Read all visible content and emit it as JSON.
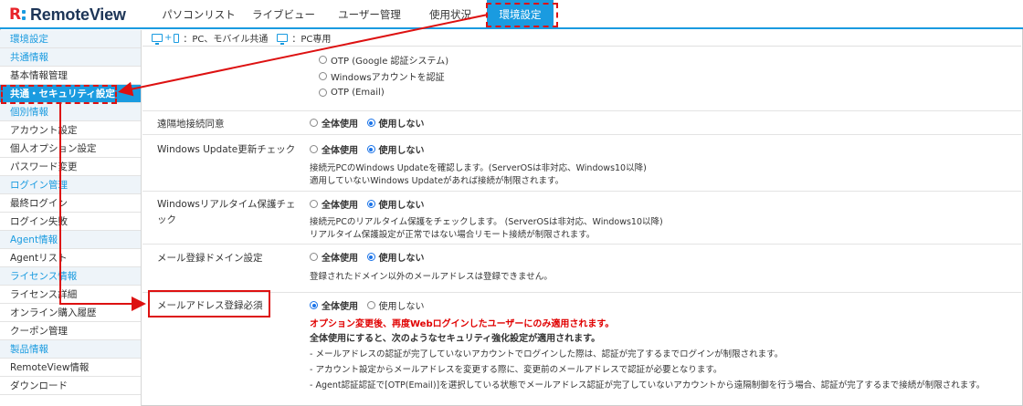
{
  "header": {
    "logo_text": "RemoteView",
    "nav": [
      {
        "label": "パソコンリスト"
      },
      {
        "label": "ライブビュー"
      },
      {
        "label": "ユーザー管理"
      },
      {
        "label": "使用状況"
      },
      {
        "label": "環境設定",
        "active": true
      }
    ]
  },
  "sidebar": {
    "items": [
      {
        "label": "環境設定",
        "type": "head"
      },
      {
        "label": "共通情報",
        "type": "head"
      },
      {
        "label": "基本情報管理",
        "type": "item"
      },
      {
        "label": "共通・セキュリティ設定",
        "type": "active"
      },
      {
        "label": "個別情報",
        "type": "head"
      },
      {
        "label": "アカウント設定",
        "type": "item"
      },
      {
        "label": "個人オプション設定",
        "type": "item"
      },
      {
        "label": "パスワード変更",
        "type": "item"
      },
      {
        "label": "ログイン管理",
        "type": "head"
      },
      {
        "label": "最終ログイン",
        "type": "item"
      },
      {
        "label": "ログイン失敗",
        "type": "item"
      },
      {
        "label": "Agent情報",
        "type": "head"
      },
      {
        "label": "Agentリスト",
        "type": "item"
      },
      {
        "label": "ライセンス情報",
        "type": "head"
      },
      {
        "label": "ライセンス詳細",
        "type": "item"
      },
      {
        "label": "オンライン購入履歴",
        "type": "item"
      },
      {
        "label": "クーポン管理",
        "type": "item"
      },
      {
        "label": "製品情報",
        "type": "head"
      },
      {
        "label": "RemoteView情報",
        "type": "item"
      },
      {
        "label": "ダウンロード",
        "type": "item"
      }
    ]
  },
  "legend": {
    "pc_mobile": "：PC、モバイル共通",
    "pc_only": "：PC専用"
  },
  "auth_options": [
    "OTP (Google 認証システム)",
    "Windowsアカウントを認証",
    "OTP (Email)"
  ],
  "settings": {
    "use_all": "全体使用",
    "not_use": "使用しない",
    "remote_consent": {
      "label": "遠隔地接続同意"
    },
    "windows_update": {
      "label": "Windows Update更新チェック",
      "desc1": "接続元PCのWindows Updateを確認します。(ServerOSは非対応、Windows10以降)",
      "desc2": "適用していないWindows Updateがあれば接続が制限されます。"
    },
    "realtime_protect": {
      "label1": "Windowsリアルタイム保護チェ",
      "label2": "ック",
      "desc1": "接続元PCのリアルタイム保護をチェックします。 (ServerOSは非対応、Windows10以降)",
      "desc2": "リアルタイム保護設定が正常ではない場合リモート接続が制限されます。"
    },
    "mail_domain": {
      "label": "メール登録ドメイン設定",
      "desc": "登録されたドメイン以外のメールアドレスは登録できません。"
    },
    "mail_required": {
      "label": "メールアドレス登録必須",
      "warning": "オプション変更後、再度Webログインしたユーザーにのみ適用されます。",
      "lead": "全体使用にすると、次のようなセキュリティ強化設定が適用されます。",
      "bullet1": "- メールアドレスの認証が完了していないアカウントでログインした際は、認証が完了するまでログインが制限されます。",
      "bullet2": "- アカウント設定からメールアドレスを変更する際に、変更前のメールアドレスで認証が必要となります。",
      "bullet3": "- Agent認証認証で[OTP(Email)]を選択している状態でメールアドレス認証が完了していないアカウントから遠隔制御を行う場合、認証が完了するまで接続が制限されます。"
    }
  },
  "colors": {
    "accent": "#1a9be0",
    "annotation": "#dd1111",
    "warning": "#e00000"
  }
}
